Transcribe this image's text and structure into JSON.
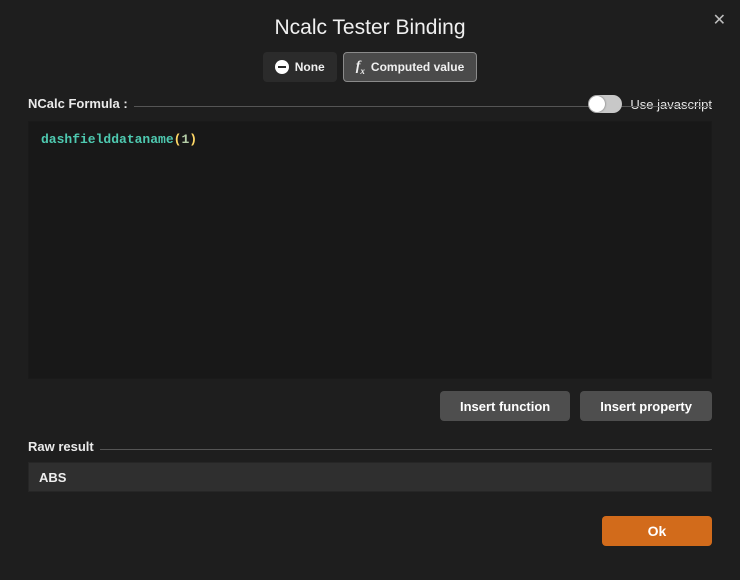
{
  "dialog": {
    "title": "Ncalc Tester Binding",
    "close_symbol": "✕"
  },
  "mode_segment": {
    "none_label": "None",
    "computed_label": "Computed value",
    "selected": "computed"
  },
  "use_js": {
    "label": "Use javascript",
    "value": false
  },
  "formula_section": {
    "label": "NCalc Formula :",
    "tokens": {
      "fn": "dashfielddataname",
      "open": "(",
      "arg": "1",
      "close": ")"
    },
    "raw_text": "dashfielddataname(1)"
  },
  "buttons": {
    "insert_function": "Insert function",
    "insert_property": "Insert property"
  },
  "raw_result": {
    "label": "Raw result",
    "value": "ABS"
  },
  "ok_label": "Ok"
}
